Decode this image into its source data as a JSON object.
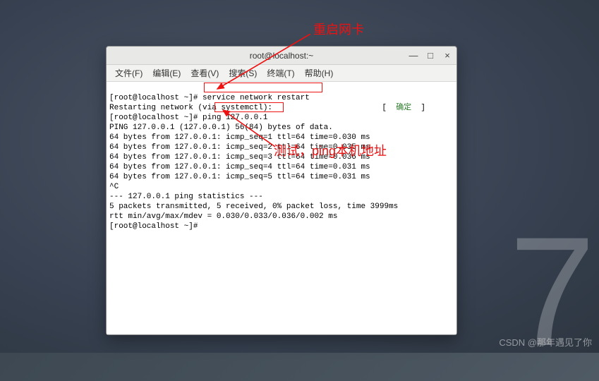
{
  "desktop": {
    "version_glyph": "7"
  },
  "window": {
    "title": "root@localhost:~",
    "controls": {
      "min": "—",
      "max": "□",
      "close": "×"
    }
  },
  "menu": {
    "file": "文件(F)",
    "edit": "编辑(E)",
    "view": "查看(V)",
    "search": "搜索(S)",
    "terminal": "终端(T)",
    "help": "帮助(H)"
  },
  "term": {
    "line0_a": "[root@localhost ~]# ",
    "line0_b": "service network restart",
    "line1": "Restarting network (via systemctl):",
    "ok_l": "[  ",
    "ok": "确定",
    "ok_r": "  ]",
    "line2_a": "[root@localhost ~]# ",
    "line2_b": "ping 127.0.0.1",
    "line3": "PING 127.0.0.1 (127.0.0.1) 56(84) bytes of data.",
    "line4": "64 bytes from 127.0.0.1: icmp_seq=1 ttl=64 time=0.030 ms",
    "line5": "64 bytes from 127.0.0.1: icmp_seq=2 ttl=64 time=0.035 ms",
    "line6": "64 bytes from 127.0.0.1: icmp_seq=3 ttl=64 time=0.036 ms",
    "line7": "64 bytes from 127.0.0.1: icmp_seq=4 ttl=64 time=0.031 ms",
    "line8": "64 bytes from 127.0.0.1: icmp_seq=5 ttl=64 time=0.031 ms",
    "line9": "^C",
    "line10": "--- 127.0.0.1 ping statistics ---",
    "line11": "5 packets transmitted, 5 received, 0% packet loss, time 3999ms",
    "line12": "rtt min/avg/max/mdev = 0.030/0.033/0.036/0.002 ms",
    "line13": "[root@localhost ~]# "
  },
  "annotations": {
    "restart_nic": "重启网卡",
    "test_ping": "测试，ping本机地址"
  },
  "watermark": {
    "csdn": "CSDN @那年遇见了你",
    "faded": ""
  }
}
